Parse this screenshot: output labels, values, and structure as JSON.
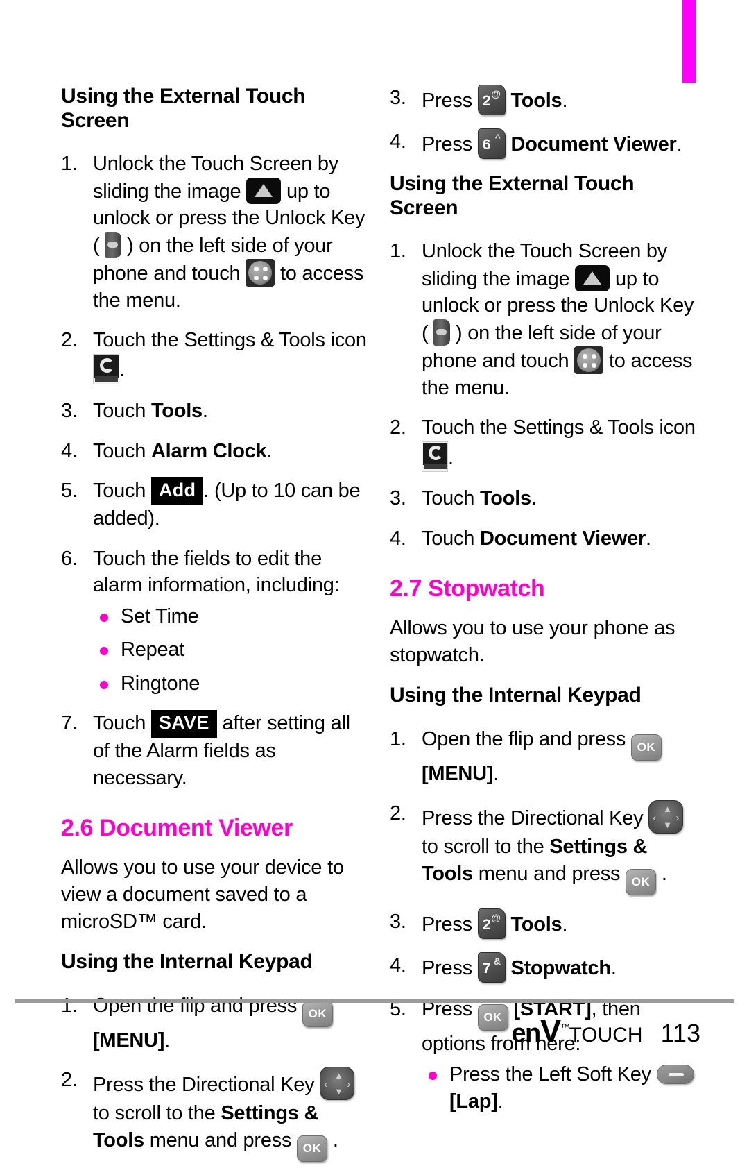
{
  "page": {
    "number": "113",
    "brand_logo": {
      "en": "en",
      "v": "V",
      "tm": "™",
      "touch": "TOUCH"
    }
  },
  "left_column": {
    "heading_external": "Using the External Touch Screen",
    "steps_alarm_external": [
      {
        "num": "1.",
        "parts": [
          {
            "t": "text",
            "v": "Unlock the Touch Screen by sliding the image "
          },
          {
            "t": "icon",
            "v": "unlock-slider-icon"
          },
          {
            "t": "text",
            "v": " up to unlock or press the Unlock Key ( "
          },
          {
            "t": "icon",
            "v": "unlock-key-icon"
          },
          {
            "t": "text",
            "v": " ) on the left side of your phone and touch "
          },
          {
            "t": "icon",
            "v": "menu-dots-icon"
          },
          {
            "t": "text",
            "v": " to access the menu."
          }
        ]
      },
      {
        "num": "2.",
        "parts": [
          {
            "t": "text",
            "v": "Touch the Settings & Tools icon "
          },
          {
            "t": "icon",
            "v": "settings-tools-icon"
          },
          {
            "t": "text",
            "v": "."
          }
        ]
      },
      {
        "num": "3.",
        "parts": [
          {
            "t": "text",
            "v": "Touch "
          },
          {
            "t": "bold",
            "v": "Tools"
          },
          {
            "t": "text",
            "v": "."
          }
        ]
      },
      {
        "num": "4.",
        "parts": [
          {
            "t": "text",
            "v": "Touch "
          },
          {
            "t": "bold",
            "v": "Alarm Clock"
          },
          {
            "t": "text",
            "v": "."
          }
        ]
      },
      {
        "num": "5.",
        "parts": [
          {
            "t": "text",
            "v": "Touch "
          },
          {
            "t": "chip",
            "v": "Add"
          },
          {
            "t": "text",
            "v": ". (Up to 10 can be added)."
          }
        ]
      },
      {
        "num": "6.",
        "parts": [
          {
            "t": "text",
            "v": "Touch the fields to edit the alarm information, including:"
          }
        ],
        "bullets": [
          "Set Time",
          "Repeat",
          "Ringtone"
        ]
      },
      {
        "num": "7.",
        "parts": [
          {
            "t": "text",
            "v": "Touch "
          },
          {
            "t": "chip",
            "v": "SAVE"
          },
          {
            "t": "text",
            "v": " after setting all of the Alarm fields as necessary."
          }
        ]
      }
    ],
    "section_doc_viewer": {
      "title": "2.6 Document Viewer",
      "description": "Allows you to use your device to view a document saved to a microSD™ card.",
      "heading_internal": "Using the Internal Keypad",
      "steps": [
        {
          "num": "1.",
          "parts": [
            {
              "t": "text",
              "v": "Open the flip and press "
            },
            {
              "t": "icon",
              "v": "ok-key-icon"
            },
            {
              "t": "text",
              "v": " "
            },
            {
              "t": "bold",
              "v": "[MENU]"
            },
            {
              "t": "text",
              "v": "."
            }
          ]
        },
        {
          "num": "2.",
          "parts": [
            {
              "t": "text",
              "v": "Press the Directional Key "
            },
            {
              "t": "icon",
              "v": "directional-key-icon"
            },
            {
              "t": "text",
              "v": " to scroll to the "
            },
            {
              "t": "bold",
              "v": "Settings & Tools"
            },
            {
              "t": "text",
              "v": " menu and press "
            },
            {
              "t": "icon",
              "v": "ok-key-icon"
            },
            {
              "t": "text",
              "v": " ."
            }
          ]
        }
      ]
    }
  },
  "right_column": {
    "steps_doc_internal_cont": [
      {
        "num": "3.",
        "parts": [
          {
            "t": "text",
            "v": "Press "
          },
          {
            "t": "icon",
            "v": "key-2-icon"
          },
          {
            "t": "text",
            "v": " "
          },
          {
            "t": "bold",
            "v": "Tools"
          },
          {
            "t": "text",
            "v": "."
          }
        ]
      },
      {
        "num": "4.",
        "parts": [
          {
            "t": "text",
            "v": "Press "
          },
          {
            "t": "icon",
            "v": "key-6-icon"
          },
          {
            "t": "text",
            "v": " "
          },
          {
            "t": "bold",
            "v": "Document Viewer"
          },
          {
            "t": "text",
            "v": "."
          }
        ]
      }
    ],
    "heading_external": "Using the External Touch Screen",
    "steps_doc_external": [
      {
        "num": "1.",
        "parts": [
          {
            "t": "text",
            "v": "Unlock the Touch Screen by sliding the image "
          },
          {
            "t": "icon",
            "v": "unlock-slider-icon"
          },
          {
            "t": "text",
            "v": " up to unlock or press the Unlock Key ( "
          },
          {
            "t": "icon",
            "v": "unlock-key-icon"
          },
          {
            "t": "text",
            "v": " ) on the left side of your phone and touch "
          },
          {
            "t": "icon",
            "v": "menu-dots-icon"
          },
          {
            "t": "text",
            "v": " to access the menu."
          }
        ]
      },
      {
        "num": "2.",
        "parts": [
          {
            "t": "text",
            "v": "Touch the Settings & Tools icon "
          },
          {
            "t": "icon",
            "v": "settings-tools-icon"
          },
          {
            "t": "text",
            "v": "."
          }
        ]
      },
      {
        "num": "3.",
        "parts": [
          {
            "t": "text",
            "v": "Touch "
          },
          {
            "t": "bold",
            "v": "Tools"
          },
          {
            "t": "text",
            "v": "."
          }
        ]
      },
      {
        "num": "4.",
        "parts": [
          {
            "t": "text",
            "v": "Touch "
          },
          {
            "t": "bold",
            "v": "Document Viewer"
          },
          {
            "t": "text",
            "v": "."
          }
        ]
      }
    ],
    "section_stopwatch": {
      "title": "2.7 Stopwatch",
      "description": "Allows you to use your phone as stopwatch.",
      "heading_internal": "Using the Internal Keypad",
      "steps": [
        {
          "num": "1.",
          "parts": [
            {
              "t": "text",
              "v": "Open the flip and press "
            },
            {
              "t": "icon",
              "v": "ok-key-icon"
            },
            {
              "t": "text",
              "v": " "
            },
            {
              "t": "bold",
              "v": "[MENU]"
            },
            {
              "t": "text",
              "v": "."
            }
          ]
        },
        {
          "num": "2.",
          "parts": [
            {
              "t": "text",
              "v": "Press the Directional Key "
            },
            {
              "t": "icon",
              "v": "directional-key-icon"
            },
            {
              "t": "text",
              "v": " to scroll to the "
            },
            {
              "t": "bold",
              "v": "Settings & Tools"
            },
            {
              "t": "text",
              "v": " menu and press "
            },
            {
              "t": "icon",
              "v": "ok-key-icon"
            },
            {
              "t": "text",
              "v": " ."
            }
          ]
        },
        {
          "num": "3.",
          "parts": [
            {
              "t": "text",
              "v": "Press "
            },
            {
              "t": "icon",
              "v": "key-2-icon"
            },
            {
              "t": "text",
              "v": " "
            },
            {
              "t": "bold",
              "v": "Tools"
            },
            {
              "t": "text",
              "v": "."
            }
          ]
        },
        {
          "num": "4.",
          "parts": [
            {
              "t": "text",
              "v": "Press "
            },
            {
              "t": "icon",
              "v": "key-7-icon"
            },
            {
              "t": "text",
              "v": " "
            },
            {
              "t": "bold",
              "v": "Stopwatch"
            },
            {
              "t": "text",
              "v": "."
            }
          ]
        },
        {
          "num": "5.",
          "parts": [
            {
              "t": "text",
              "v": "Press "
            },
            {
              "t": "icon",
              "v": "ok-key-icon"
            },
            {
              "t": "text",
              "v": " "
            },
            {
              "t": "bold",
              "v": "[START]"
            },
            {
              "t": "text",
              "v": ", then options from here:"
            }
          ],
          "bullets_rich": [
            [
              {
                "t": "text",
                "v": "Press the Left Soft Key "
              },
              {
                "t": "icon",
                "v": "left-soft-key-icon"
              },
              {
                "t": "text",
                "v": " "
              },
              {
                "t": "bold",
                "v": "[Lap]"
              },
              {
                "t": "text",
                "v": "."
              }
            ]
          ]
        }
      ]
    }
  },
  "keys": {
    "ok_label": "OK",
    "key2": {
      "digit": "2",
      "sub": "@"
    },
    "key6": {
      "digit": "6",
      "sub": "^"
    },
    "key7": {
      "digit": "7",
      "sub": "&"
    }
  },
  "colors": {
    "accent_magenta": "#ff00cc",
    "tab_marker": "#ff00ff",
    "footer_rule": "#9a9a9a"
  }
}
